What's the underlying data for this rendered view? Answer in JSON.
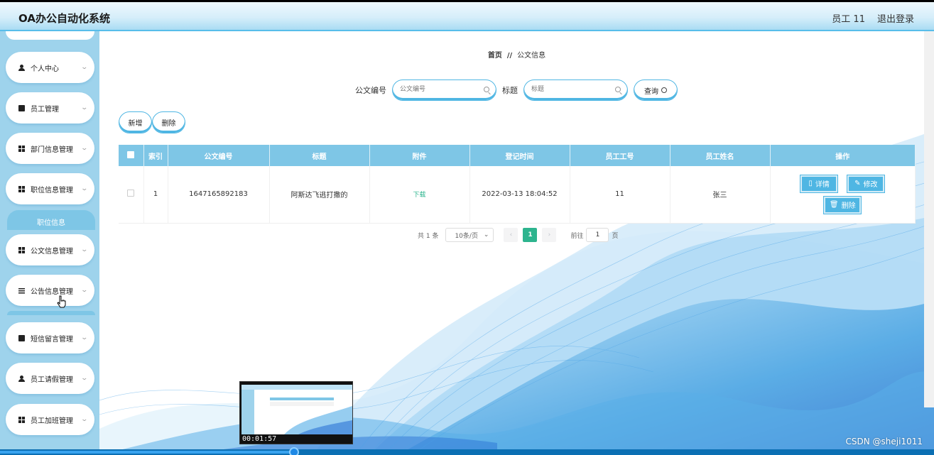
{
  "header": {
    "title": "OA办公自动化系统",
    "user": "员工 11",
    "logout": "退出登录"
  },
  "sidebar": {
    "items": [
      {
        "label": "个人中心",
        "icon": "person-icon"
      },
      {
        "label": "员工管理",
        "icon": "clipboard-icon"
      },
      {
        "label": "部门信息管理",
        "icon": "grid-icon"
      },
      {
        "label": "职位信息管理",
        "icon": "grid-icon"
      },
      {
        "label": "公文信息管理",
        "icon": "grid-icon"
      },
      {
        "label": "公告信息管理",
        "icon": "list-icon"
      },
      {
        "label": "短信留言管理",
        "icon": "chart-icon"
      },
      {
        "label": "员工请假管理",
        "icon": "person-icon"
      },
      {
        "label": "员工加班管理",
        "icon": "grid-icon"
      }
    ],
    "sub_item": "职位信息"
  },
  "breadcrumb": {
    "home": "首页",
    "sep": "//",
    "current": "公文信息"
  },
  "search": {
    "field1_label": "公文编号",
    "field1_placeholder": "公文编号",
    "field2_label": "标题",
    "field2_placeholder": "标题",
    "query": "查询"
  },
  "actions": {
    "add": "新增",
    "delete": "删除"
  },
  "table": {
    "headers": [
      "索引",
      "公文编号",
      "标题",
      "附件",
      "登记时间",
      "员工工号",
      "员工姓名",
      "操作"
    ],
    "rows": [
      {
        "index": "1",
        "doc_no": "1647165892183",
        "title": "阿斯达飞逃打撒的",
        "attachment": "下载",
        "time": "2022-03-13 18:04:52",
        "emp_no": "11",
        "emp_name": "张三"
      }
    ],
    "ops": {
      "detail": "详情",
      "edit": "修改",
      "delete": "删除"
    }
  },
  "pager": {
    "total": "共 1 条",
    "size": "10条/页",
    "current": "1",
    "goto": "前往",
    "goto_value": "1",
    "page_unit": "页"
  },
  "video": {
    "time": "00:01:57",
    "progress": 0.315
  },
  "watermark": "CSDN @sheji1011",
  "colors": {
    "accent": "#7ec6e6",
    "border": "#4fb6e3",
    "green": "#2db48e"
  }
}
